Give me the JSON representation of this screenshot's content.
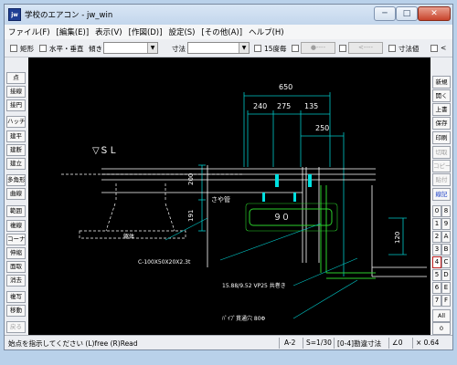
{
  "window": {
    "title": "学校のエアコン - jw_win",
    "icon_text": "jw",
    "minimize": "─",
    "maximize": "□",
    "close": "✕"
  },
  "menu": [
    "ファイル(F)",
    "[編集(E)]",
    "表示(V)",
    "[作図(D)]",
    "設定(S)",
    "[その他(A)]",
    "ヘルプ(H)"
  ],
  "toolbar": {
    "rect": "矩形",
    "horizontal_vertical": "水平・垂直",
    "tilt": "傾き",
    "dimension": "寸法",
    "deg15": "15度毎",
    "btn1": "●----",
    "btn2": "<----",
    "dim_value": "寸法値",
    "lt": "<"
  },
  "left_tools": [
    "点",
    "接線",
    "接円",
    "ハッチ",
    "建平",
    "建断",
    "建立",
    "多角形",
    "曲線",
    "範囲",
    "複線",
    "コーナー",
    "伸縮",
    "面取",
    "消去",
    "複写",
    "移動",
    "戻る"
  ],
  "right_tools": [
    "新規",
    "開く",
    "上書",
    "保存",
    "印刷",
    "切取",
    "コピー",
    "貼付",
    "線記",
    "All"
  ],
  "layers": [
    "0",
    "1",
    "2",
    "3",
    "4",
    "5",
    "6",
    "7",
    "8",
    "9",
    "A",
    "B",
    "C",
    "D",
    "E",
    "F"
  ],
  "zoom_button": "0",
  "drawing": {
    "dims_top": [
      "650",
      "240",
      "275",
      "135",
      "250"
    ],
    "dims_left": [
      "200",
      "191"
    ],
    "dim_right": "120",
    "gl_label": "▽ＳＬ",
    "label_sayadou": "さや管",
    "label_90": "９０",
    "label_yukashita": "躯体",
    "label_channel": "C-100X50X20X2.3t",
    "label_pipe": "15.88/9.52 VP25 共巻き",
    "label_sleeve": "ﾊﾟｲﾌﾟ貫通穴 80Φ"
  },
  "status": {
    "message": "始点を指示してください (L)free (R)Read",
    "paper": "A-2",
    "scale": "S=1/30",
    "layer": "[0-4]勘違寸法",
    "angle": "∠0",
    "zoom": "× 0.64"
  },
  "colors": {
    "canvas_bg": "#000000",
    "dim_line": "#00c8c8",
    "cyan": "#00e0e0",
    "white_line": "#ffffff",
    "green": "#2bd12b",
    "yellow": "#e0e000"
  }
}
